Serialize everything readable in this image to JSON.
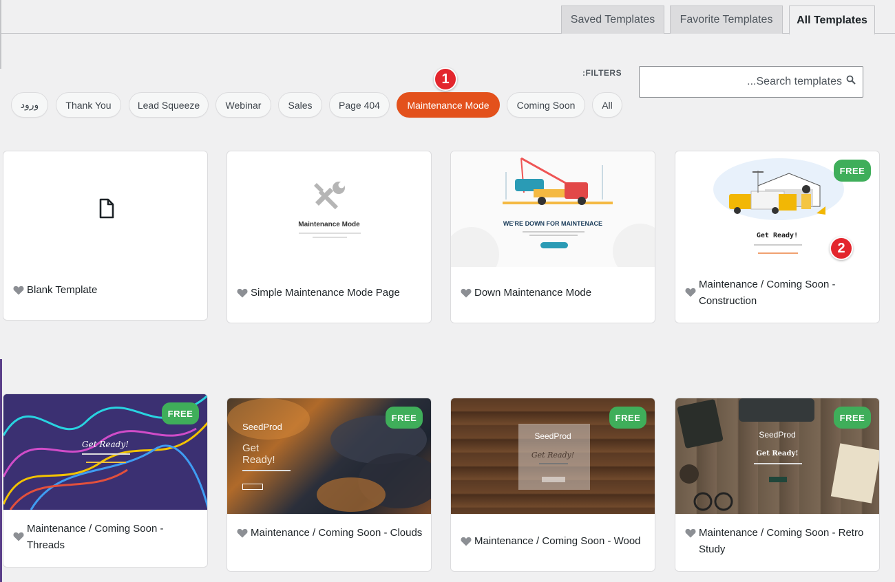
{
  "tabs": [
    {
      "label": "Saved Templates"
    },
    {
      "label": "Favorite Templates"
    },
    {
      "label": "All Templates"
    }
  ],
  "filters": {
    "label": ":FILTERS",
    "search_placeholder": "...Search templates",
    "pills": [
      {
        "label": "ورود"
      },
      {
        "label": "Thank You"
      },
      {
        "label": "Lead Squeeze"
      },
      {
        "label": "Webinar"
      },
      {
        "label": "Sales"
      },
      {
        "label": "Page 404"
      },
      {
        "label": "Maintenance Mode"
      },
      {
        "label": "Coming Soon"
      },
      {
        "label": "All"
      }
    ]
  },
  "markers": [
    "1",
    "2"
  ],
  "badge_label": "FREE",
  "cards": [
    {
      "title": "Blank Template"
    },
    {
      "title": "Simple Maintenance Mode Page",
      "preview_heading": "Maintenance Mode"
    },
    {
      "title": "Down Maintenance Mode",
      "preview_heading": "WE'RE DOWN FOR MAINTENACE"
    },
    {
      "title": "Maintenance / Coming Soon - Construction",
      "preview_heading": "Get Ready!"
    },
    {
      "title": "Maintenance / Coming Soon - Threads",
      "preview_heading": "Get Ready!"
    },
    {
      "title": "Maintenance / Coming Soon - Clouds",
      "preview_brand": "SeedProd",
      "preview_heading": "Get Ready!"
    },
    {
      "title": "Maintenance / Coming Soon - Wood",
      "preview_brand": "SeedProd",
      "preview_heading": "Get Ready!"
    },
    {
      "title": "Maintenance / Coming Soon - Retro Study",
      "preview_brand": "SeedProd",
      "preview_heading": "Get Ready!"
    }
  ],
  "colors": {
    "accent": "#e3511c",
    "free_badge": "#3fae5a",
    "marker": "#e3262d"
  }
}
